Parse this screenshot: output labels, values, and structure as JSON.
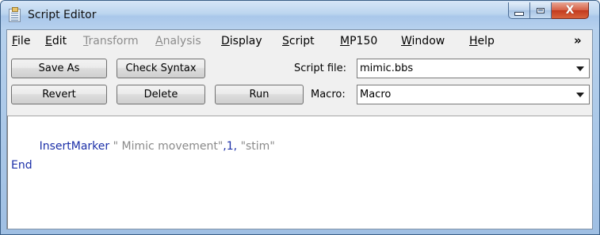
{
  "window": {
    "title": "Script Editor",
    "close_glyph": "X"
  },
  "menu": [
    {
      "mnemonic": "F",
      "rest": "ile",
      "enabled": true
    },
    {
      "mnemonic": "E",
      "rest": "dit",
      "enabled": true
    },
    {
      "mnemonic": "T",
      "rest": "ransform",
      "enabled": false
    },
    {
      "mnemonic": "A",
      "rest": "nalysis",
      "enabled": false
    },
    {
      "mnemonic": "D",
      "rest": "isplay",
      "enabled": true
    },
    {
      "mnemonic": "S",
      "rest": "cript",
      "enabled": true
    },
    {
      "mnemonic": "M",
      "rest": "P150",
      "enabled": true
    },
    {
      "mnemonic": "W",
      "rest": "indow",
      "enabled": true
    },
    {
      "mnemonic": "H",
      "rest": "elp",
      "enabled": true
    }
  ],
  "menu_overflow": "»",
  "toolbar": {
    "save_as": "Save As",
    "check_syntax": "Check Syntax",
    "script_file_label": "Script file:",
    "script_file_value": "mimic.bbs",
    "revert": "Revert",
    "delete": "Delete",
    "run": "Run",
    "macro_label": "Macro:",
    "macro_value": "Macro"
  },
  "editor": {
    "line1": {
      "keyword": "InsertMarker",
      "string1": " \" Mimic movement\"",
      "middle": ",1, ",
      "string2": "\"stim\""
    },
    "line2": "End"
  },
  "colors": {
    "keyword": "#1b2fa8",
    "string": "#8a8a8a",
    "disabled_menu": "#8c8c8c"
  }
}
